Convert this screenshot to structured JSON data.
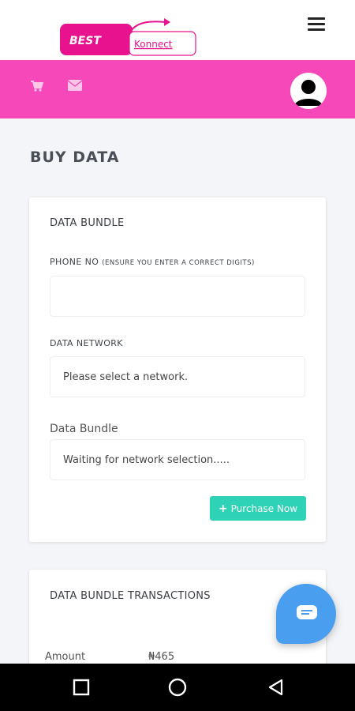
{
  "header": {
    "logo_text_primary": "BEST",
    "logo_text_secondary": "Konnect",
    "menu_icon": "hamburger-menu-icon"
  },
  "toolbar": {
    "cart_icon": "cart-icon",
    "mail_icon": "mail-icon",
    "avatar_icon": "user-avatar-icon"
  },
  "page": {
    "title": "BUY DATA"
  },
  "form": {
    "card_title": "DATA BUNDLE",
    "phone_label": "PHONE NO",
    "phone_hint": "(ENSURE YOU ENTER A CORRECT DIGITS)",
    "phone_value": "",
    "network_label": "DATA NETWORK",
    "network_value": "Please select a network.",
    "bundle_label": "Data Bundle",
    "bundle_value": "Waiting for network selection.....",
    "purchase_label": "Purchase Now"
  },
  "transactions": {
    "card_title": "DATA BUNDLE TRANSACTIONS",
    "amount_label": "Amount",
    "amount_value": "₦465"
  },
  "chat_fab": {
    "icon": "chat-icon"
  },
  "android_nav": {
    "recent_icon": "recent-apps-icon",
    "home_icon": "home-icon",
    "back_icon": "back-icon"
  },
  "colors": {
    "brand_pink": "#f648b8",
    "accent_teal": "#2dd3b4",
    "fab_blue": "#4a9ef0"
  }
}
